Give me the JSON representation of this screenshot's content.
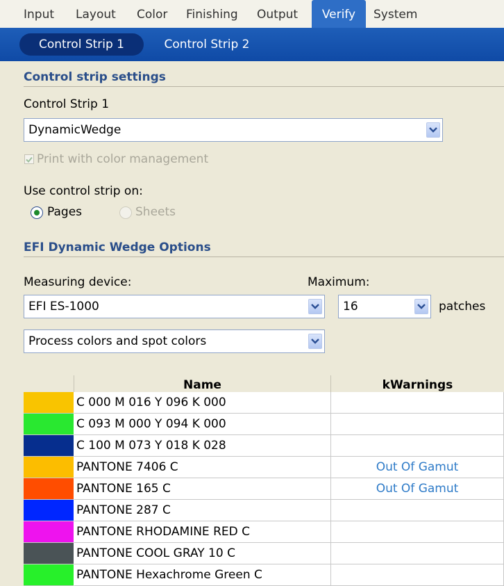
{
  "top_tabs": [
    {
      "label": "Input"
    },
    {
      "label": "Layout"
    },
    {
      "label": "Color"
    },
    {
      "label": "Finishing"
    },
    {
      "label": "Output"
    },
    {
      "label": "Verify",
      "active": true
    },
    {
      "label": "System"
    }
  ],
  "sub_tabs": [
    {
      "label": "Control Strip 1",
      "active": true
    },
    {
      "label": "Control Strip 2"
    }
  ],
  "control_strip_settings": {
    "title": "Control strip settings",
    "strip_label": "Control Strip 1",
    "strip_value": "DynamicWedge",
    "print_color_mgmt_label": "Print with color management",
    "print_color_mgmt_checked": true,
    "use_on_label": "Use control strip on:",
    "pages_label": "Pages",
    "sheets_label": "Sheets",
    "selected": "Pages"
  },
  "dynamic_wedge": {
    "title": "EFI Dynamic Wedge Options",
    "measuring_device_label": "Measuring device:",
    "measuring_device_value": "EFI ES-1000",
    "maximum_label": "Maximum:",
    "maximum_value": "16",
    "patches_label": "patches",
    "colors_value": "Process colors and spot colors"
  },
  "table": {
    "headers": {
      "name": "Name",
      "warnings": "kWarnings"
    },
    "rows": [
      {
        "color": "#f9c400",
        "name": "C 000  M 016  Y 096  K 000",
        "warning": ""
      },
      {
        "color": "#29e830",
        "name": "C 093  M 000  Y 094  K 000",
        "warning": ""
      },
      {
        "color": "#062e8e",
        "name": "C 100  M 073  Y 018  K 028",
        "warning": ""
      },
      {
        "color": "#fcbd00",
        "name": "PANTONE 7406 C",
        "warning": "Out Of Gamut"
      },
      {
        "color": "#ff4d00",
        "name": "PANTONE 165 C",
        "warning": "Out Of Gamut"
      },
      {
        "color": "#0026ff",
        "name": "PANTONE 287 C",
        "warning": ""
      },
      {
        "color": "#ee13ee",
        "name": "PANTONE RHODAMINE RED C",
        "warning": ""
      },
      {
        "color": "#4a5356",
        "name": "PANTONE COOL GRAY 10 C",
        "warning": ""
      },
      {
        "color": "#27f02a",
        "name": "PANTONE Hexachrome Green C",
        "warning": ""
      }
    ]
  }
}
